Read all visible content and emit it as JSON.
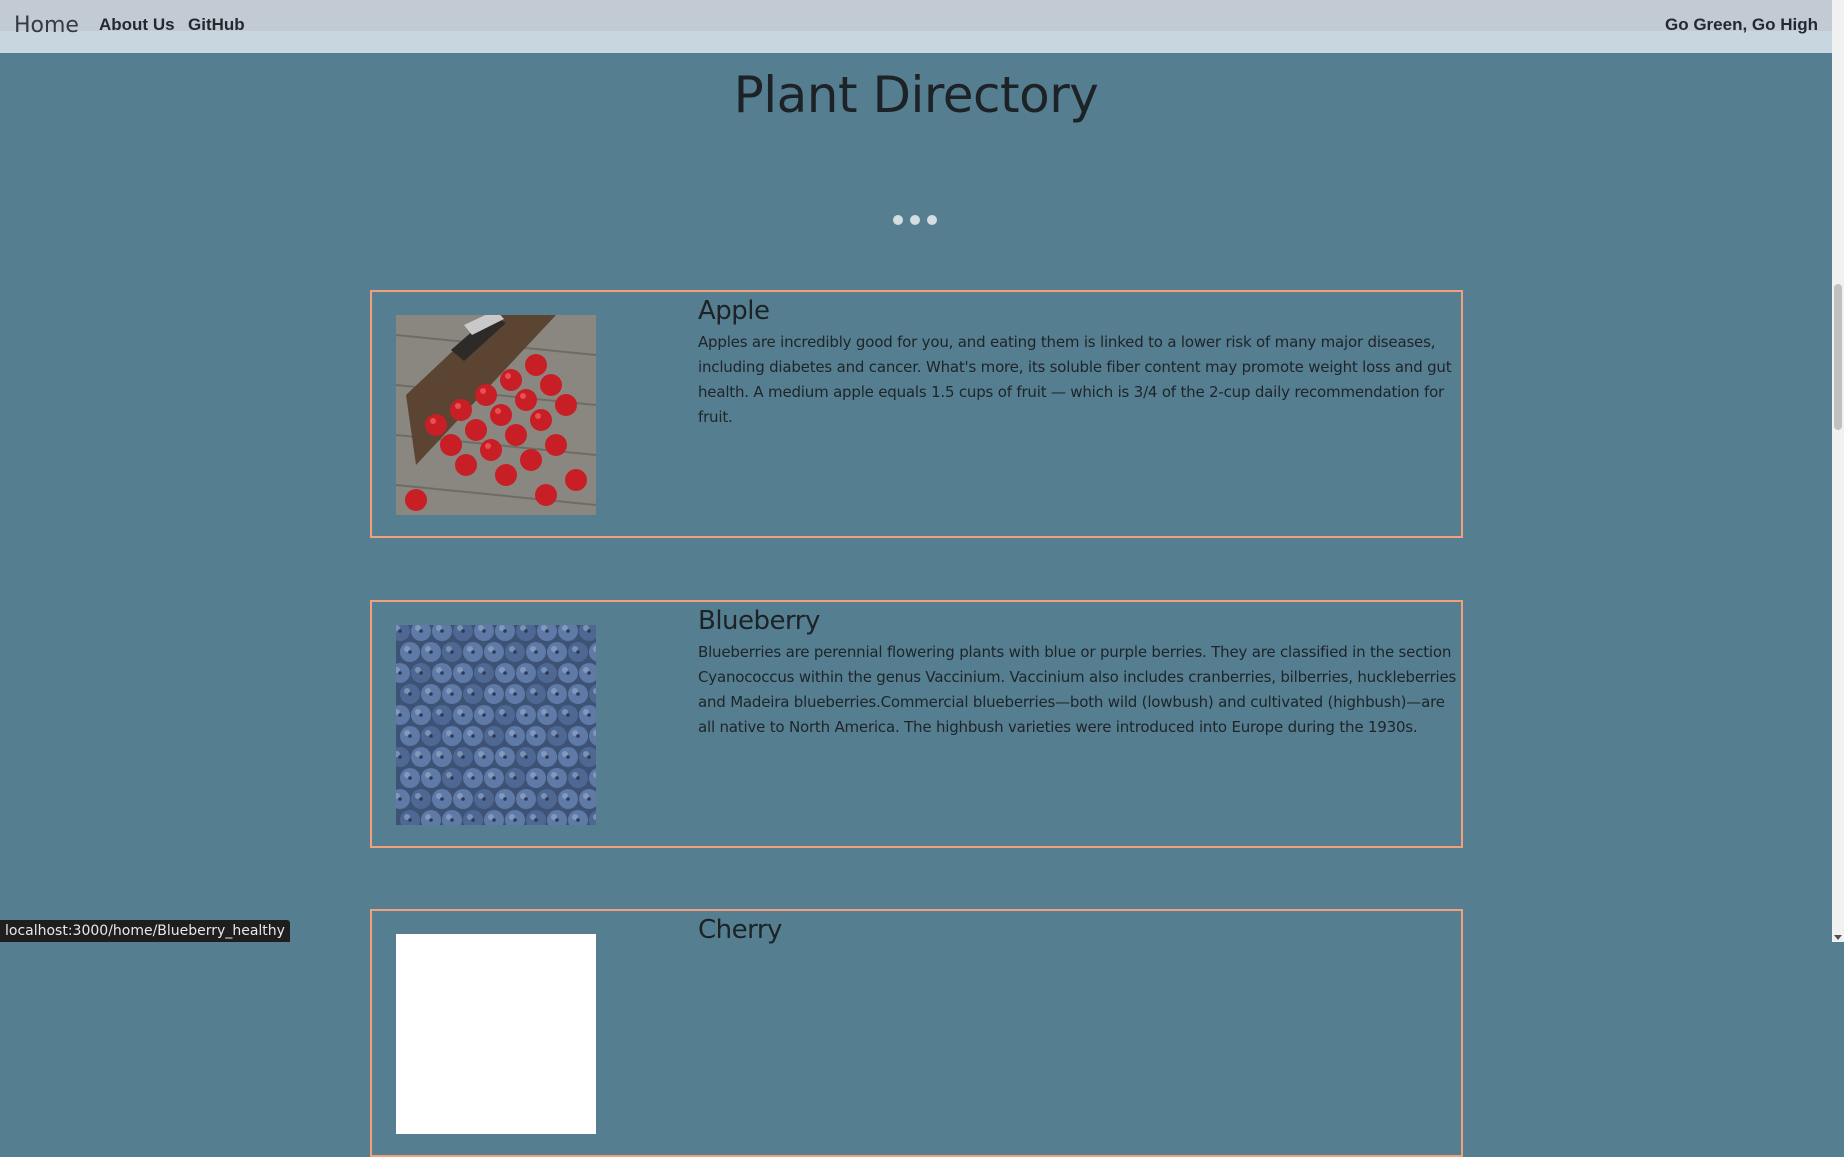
{
  "nav": {
    "home": "Home",
    "about": "About Us",
    "github": "GitHub",
    "slogan": "Go Green, Go High"
  },
  "page": {
    "title": "Plant Directory"
  },
  "carousel": {
    "dot_count": 3
  },
  "plants": [
    {
      "name": "Apple",
      "image_icon": "apple-image",
      "description": "Apples are incredibly good for you, and eating them is linked to a lower risk of many major diseases, including diabetes and cancer. What's more, its soluble fiber content may promote weight loss and gut health. A medium apple equals 1.5 cups of fruit — which is 3/4 of the 2-cup daily recommendation for fruit."
    },
    {
      "name": "Blueberry",
      "image_icon": "blueberry-image",
      "description": "Blueberries are perennial flowering plants with blue or purple berries. They are classified in the section Cyanococcus within the genus Vaccinium. Vaccinium also includes cranberries, bilberries, huckleberries and Madeira blueberries.Commercial blueberries—both wild (lowbush) and cultivated (highbush)—are all native to North America. The highbush varieties were introduced into Europe during the 1930s."
    },
    {
      "name": "Cherry",
      "image_icon": "cherry-image",
      "description": ""
    }
  ],
  "status": {
    "link_preview": "localhost:3000/home/Blueberry_healthy"
  },
  "colors": {
    "background": "#557f90",
    "card_border": "#f0a07a",
    "navbar": "#c8d7df"
  }
}
